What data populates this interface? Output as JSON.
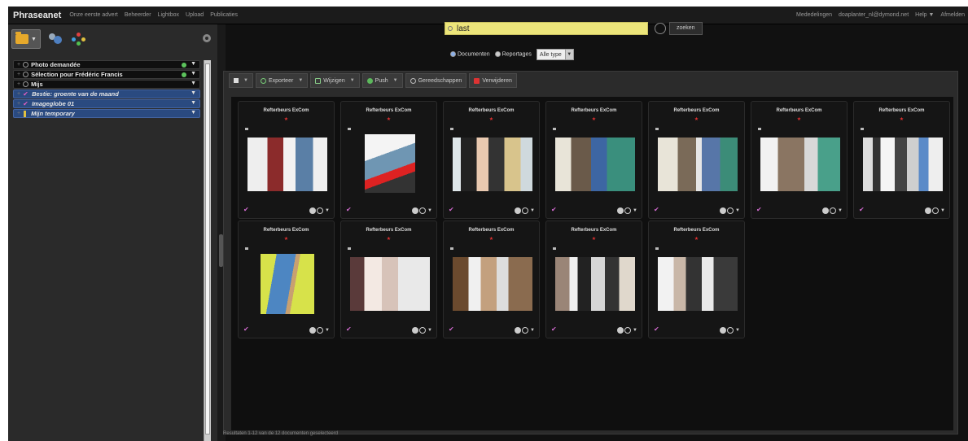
{
  "app": {
    "brand": "Phraseanet"
  },
  "topnav": [
    "Onze eerste advert",
    "Beheerder",
    "Lightbox",
    "Upload",
    "Publicaties"
  ],
  "topright": [
    "Mededelingen",
    "doaplanter_nl@dymond.net",
    "Help ▼",
    "Afmelden"
  ],
  "left_panel": {
    "baskets": [
      {
        "label": "Photo demandée",
        "kind": "circle",
        "style": "dark",
        "dot": true
      },
      {
        "label": "Sélection pour Frédéric Francis",
        "kind": "circle",
        "style": "dark",
        "dot": true
      },
      {
        "label": "Mijs",
        "kind": "circle",
        "style": "dark",
        "dot": false
      },
      {
        "label": "Bestie: groente van de maand",
        "kind": "pink",
        "style": "blue",
        "dot": false
      },
      {
        "label": "Imageglobe 01",
        "kind": "pink",
        "style": "blue",
        "dot": false
      },
      {
        "label": "Mijn temporary",
        "kind": "tag",
        "style": "blue",
        "dot": false
      }
    ]
  },
  "search": {
    "value": "last",
    "button": "zoeken"
  },
  "filters": {
    "documents": "Documenten",
    "reports": "Reportages",
    "type": "Alle type"
  },
  "toolbar": {
    "export": "Exporteer",
    "edit": "Wijzigen",
    "push": "Push",
    "tools": "Gereedschappen",
    "delete": "Verwijderen"
  },
  "cards": [
    {
      "title": "Refterbeurs ExCom",
      "star": "★"
    },
    {
      "title": "Refterbeurs ExCom",
      "star": "★"
    },
    {
      "title": "Refterbeurs ExCom",
      "star": "★"
    },
    {
      "title": "Refterbeurs ExCom",
      "star": "★"
    },
    {
      "title": "Refterbeurs ExCom",
      "star": "★"
    },
    {
      "title": "Refterbeurs ExCom",
      "star": "★"
    },
    {
      "title": "Refterbeurs ExCom",
      "star": "★"
    },
    {
      "title": "Refterbeurs ExCom",
      "star": "★"
    },
    {
      "title": "Refterbeurs ExCom",
      "star": "★"
    },
    {
      "title": "Refterbeurs ExCom",
      "star": "★"
    },
    {
      "title": "Refterbeurs ExCom",
      "star": "★"
    },
    {
      "title": "Refterbeurs ExCom",
      "star": "★"
    }
  ],
  "status": "Resultaten 1-12 van de 12 documenten geselecteerd"
}
